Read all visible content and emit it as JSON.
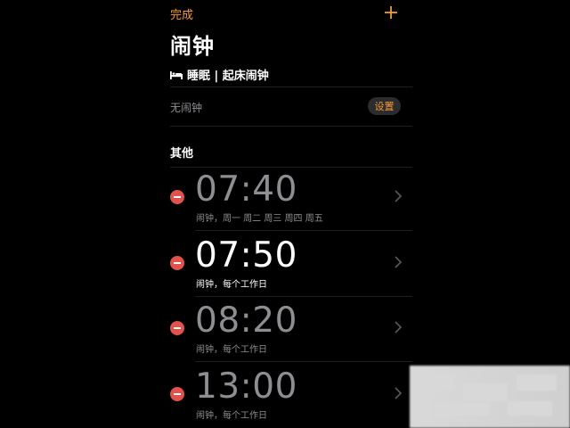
{
  "header": {
    "done_label": "完成",
    "title": "闹钟"
  },
  "sleep": {
    "section_label": "睡眠 | 起床闹钟",
    "no_alarm_text": "无闹钟",
    "settings_label": "设置"
  },
  "others": {
    "section_label": "其他"
  },
  "alarms": [
    {
      "time": "07:40",
      "label": "闹钟，周一 周二 周三 周四 周五",
      "enabled": false
    },
    {
      "time": "07:50",
      "label": "闹钟，每个工作日",
      "enabled": true
    },
    {
      "time": "08:20",
      "label": "闹钟，每个工作日",
      "enabled": false
    },
    {
      "time": "13:00",
      "label": "闹钟，每个工作日",
      "enabled": false
    }
  ],
  "colors": {
    "accent": "#f29a3c",
    "delete": "#e0524b",
    "dim_text": "#8d8d92",
    "background": "#000000"
  },
  "icons": {
    "add": "plus-icon",
    "bed": "bed-icon",
    "chevron": "chevron-right-icon",
    "delete": "minus-circle-icon"
  }
}
